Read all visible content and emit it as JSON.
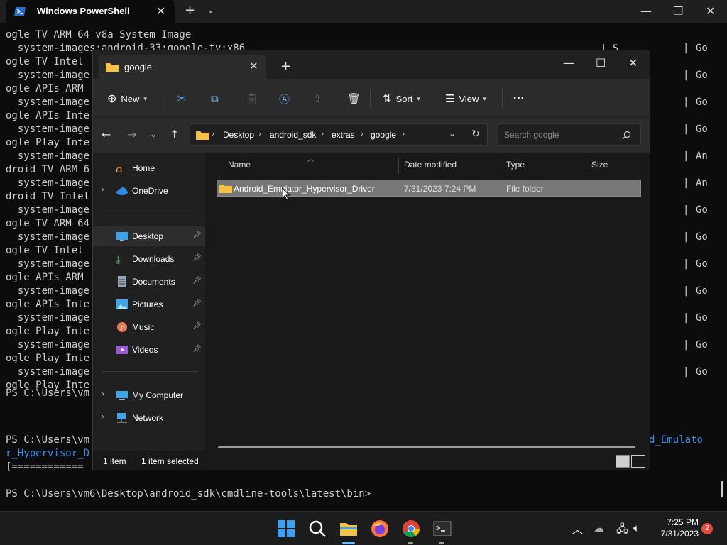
{
  "powershell": {
    "title": "Windows PowerShell",
    "lines": [
      "ogle TV ARM 64 v8a System Image",
      "  system-images;android-33;google-tv;x86",
      "ogle TV Intel",
      "  system-image",
      "ogle APIs ARM",
      "  system-image",
      "ogle APIs Inte",
      "  system-image",
      "ogle Play Inte",
      "  system-image",
      "droid TV ARM 6",
      "  system-image",
      "droid TV Intel",
      "  system-image",
      "ogle TV ARM 64",
      "  system-image",
      "ogle TV Intel",
      "  system-image",
      "ogle APIs ARM",
      "  system-image",
      "ogle APIs Inte",
      "  system-image",
      "ogle Play Inte",
      "  system-image",
      "ogle Play Inte",
      "  system-image",
      "ogle Play Inte"
    ],
    "right_col": [
      "Go",
      "Go",
      "Go",
      "Go",
      "An",
      "An",
      "Go",
      "Go",
      "Go",
      "Go",
      "Go",
      "Go",
      "Go"
    ],
    "mid_text": "| 5",
    "prompt1": "PS C:\\Users\\vm",
    "prompt2": "PS C:\\Users\\vm",
    "wrap_left": "r_Hypervisor_D",
    "wrap_right": "d_Emulato",
    "progress": "[============",
    "prompt_final": "PS C:\\Users\\vm6\\Desktop\\android_sdk\\cmdline-tools\\latest\\bin>"
  },
  "explorer": {
    "tab_title": "google",
    "toolbar": {
      "new_label": "New",
      "sort_label": "Sort",
      "view_label": "View",
      "more_label": "···"
    },
    "breadcrumb": [
      "Desktop",
      "android_sdk",
      "extras",
      "google"
    ],
    "search_placeholder": "Search google",
    "nav": {
      "home": "Home",
      "onedrive": "OneDrive",
      "desktop": "Desktop",
      "downloads": "Downloads",
      "documents": "Documents",
      "pictures": "Pictures",
      "music": "Music",
      "videos": "Videos",
      "mycomputer": "My Computer",
      "network": "Network"
    },
    "columns": {
      "name": "Name",
      "date": "Date modified",
      "type": "Type",
      "size": "Size"
    },
    "files": [
      {
        "name": "Android_Emulator_Hypervisor_Driver",
        "date": "7/31/2023 7:24 PM",
        "type": "File folder",
        "size": ""
      }
    ],
    "status": {
      "count": "1 item",
      "selected": "1 item selected"
    }
  },
  "taskbar": {
    "time": "7:25 PM",
    "date": "7/31/2023",
    "badge": "2"
  },
  "colors": {
    "accent": "#0078d4",
    "folder": "#f5c344",
    "selection": "#777777"
  }
}
